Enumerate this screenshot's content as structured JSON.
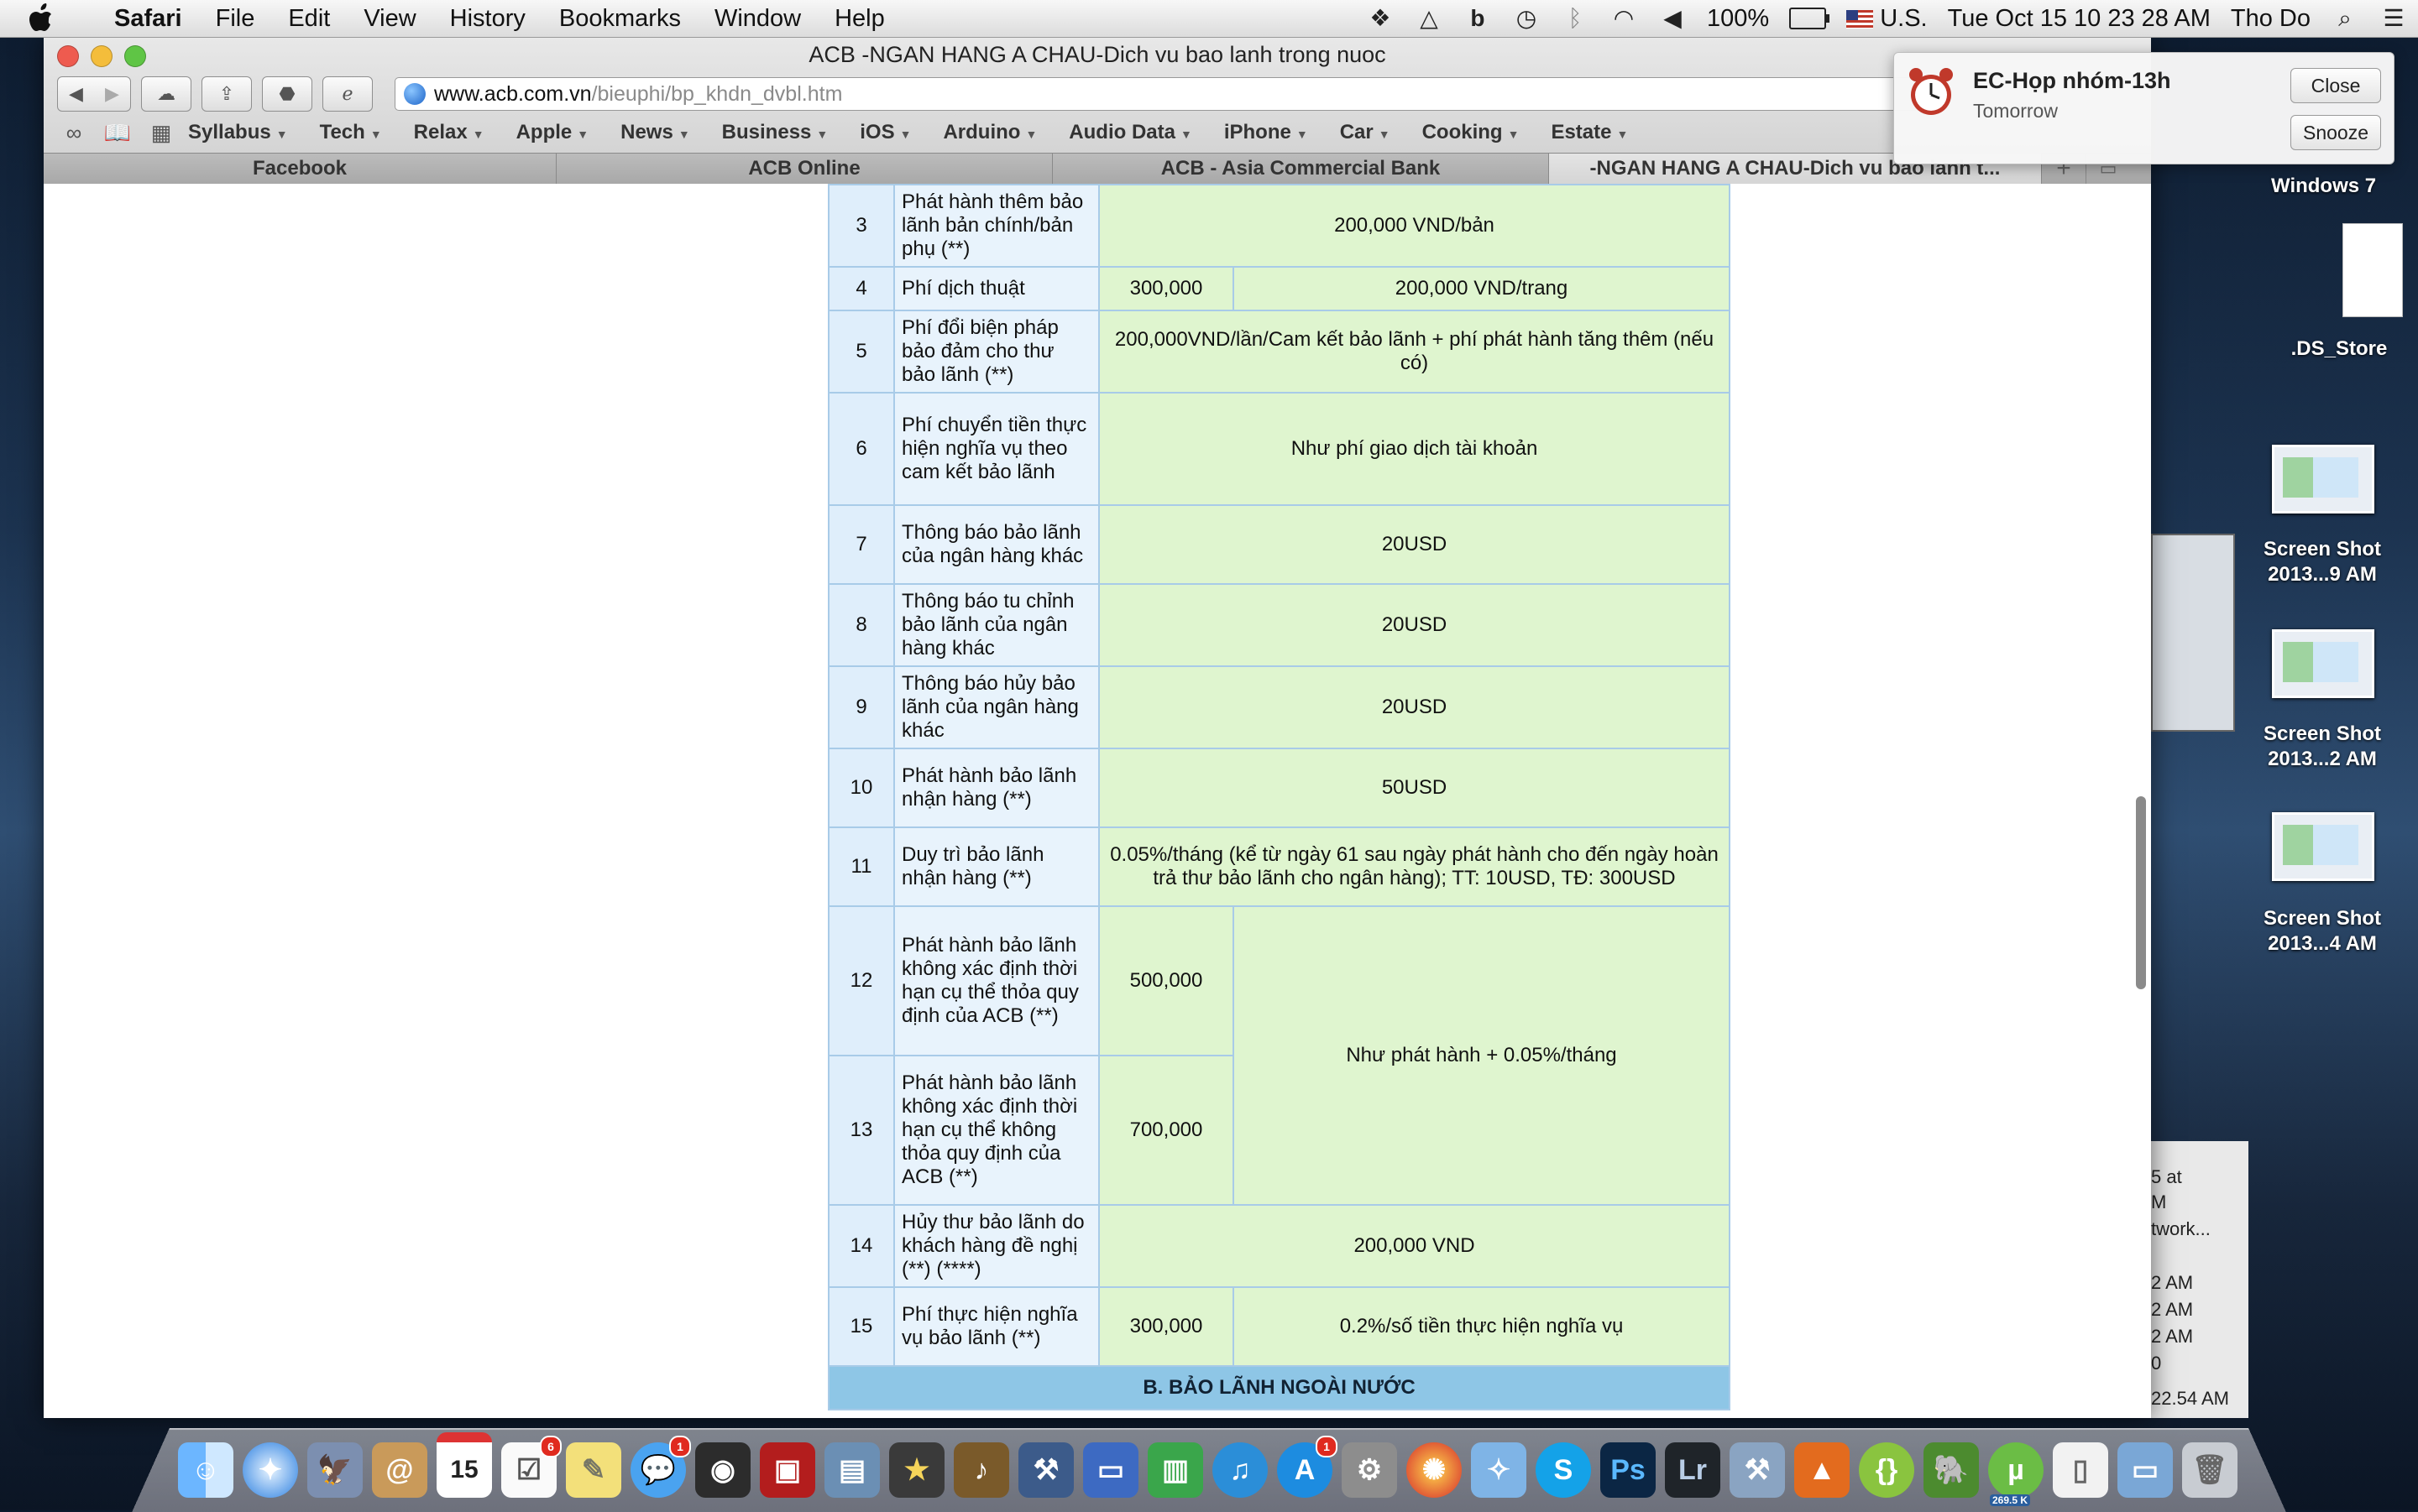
{
  "menubar": {
    "app": "Safari",
    "items": [
      "File",
      "Edit",
      "View",
      "History",
      "Bookmarks",
      "Window",
      "Help"
    ],
    "battery": "100%",
    "input_source": "U.S.",
    "datetime": "Tue Oct 15  10 23 28 AM",
    "user": "Tho Do"
  },
  "window": {
    "title": "ACB -NGAN HANG A CHAU-Dich vu bao lanh trong nuoc",
    "url_host": "www.acb.com.vn",
    "url_path": "/bieuphi/bp_khdn_dvbl.htm",
    "bookmarks": [
      "Syllabus",
      "Tech",
      "Relax",
      "Apple",
      "News",
      "Business",
      "iOS",
      "Arduino",
      "Audio Data",
      "iPhone",
      "Car",
      "Cooking",
      "Estate"
    ],
    "tabs": [
      "Facebook",
      "ACB Online",
      "ACB - Asia Commercial Bank",
      "-NGAN HANG A CHAU-Dich vu bao lanh t..."
    ]
  },
  "table": {
    "rows": {
      "r3": {
        "no": "3",
        "name": "Phát hành thêm bảo lãnh bản chính/bản phụ (**)",
        "value": "200,000 VND/bản"
      },
      "r4": {
        "no": "4",
        "name": "Phí dịch thuật",
        "min": "300,000",
        "value": "200,000 VND/trang"
      },
      "r5": {
        "no": "5",
        "name": "Phí đổi biện pháp bảo đảm cho thư bảo lãnh (**)",
        "value": "200,000VND/lần/Cam kết bảo lãnh + phí phát hành tăng thêm (nếu có)"
      },
      "r6": {
        "no": "6",
        "name": "Phí chuyển tiền thực hiện nghĩa vụ theo cam kết bảo lãnh",
        "value": "Như phí giao dịch tài khoản"
      },
      "r7": {
        "no": "7",
        "name": "Thông báo bảo lãnh của ngân hàng khác",
        "value": "20USD"
      },
      "r8": {
        "no": "8",
        "name": "Thông báo tu chỉnh bảo lãnh của ngân hàng khác",
        "value": "20USD"
      },
      "r9": {
        "no": "9",
        "name": "Thông báo hủy bảo lãnh của ngân hàng khác",
        "value": "20USD"
      },
      "r10": {
        "no": "10",
        "name": "Phát hành bảo lãnh nhận hàng (**)",
        "value": "50USD"
      },
      "r11": {
        "no": "11",
        "name": "Duy trì bảo lãnh nhận hàng (**)",
        "value": "0.05%/tháng (kể từ ngày 61 sau ngày phát hành cho đến ngày hoàn trả thư bảo lãnh cho ngân hàng); TT: 10USD, TĐ: 300USD"
      },
      "r12": {
        "no": "12",
        "name": "Phát hành bảo lãnh không xác định thời hạn cụ thể thỏa quy định của ACB (**)",
        "min": "500,000",
        "value": "Như phát hành + 0.05%/tháng"
      },
      "r13": {
        "no": "13",
        "name": "Phát hành bảo lãnh không xác định thời hạn cụ thể không thỏa quy định của ACB (**)",
        "min": "700,000"
      },
      "r14": {
        "no": "14",
        "name": "Hủy thư bảo lãnh do khách hàng đề nghị (**) (****)",
        "value": "200,000 VND"
      },
      "r15": {
        "no": "15",
        "name": "Phí thực hiện nghĩa vụ bảo lãnh (**)",
        "min": "300,000",
        "value": "0.2%/số tiền thực hiện nghĩa vụ"
      }
    },
    "section_b": "B. BẢO LÃNH NGOÀI NƯỚC"
  },
  "notification": {
    "title": "EC-Họp nhóm-13h",
    "subtitle": "Tomorrow",
    "close_label": "Close",
    "snooze_label": "Snooze"
  },
  "desktop": {
    "volume": "Windows 7",
    "file": ".DS_Store",
    "shots": [
      {
        "line1": "Screen Shot",
        "line2": "2013...9 AM"
      },
      {
        "line1": "Screen Shot",
        "line2": "2013...2 AM"
      },
      {
        "line1": "Screen Shot",
        "line2": "2013...4 AM"
      }
    ],
    "peek_lines": [
      "5 at",
      "M",
      "twork...",
      "2 AM",
      "2 AM",
      "2 AM",
      "0",
      "22.54 AM"
    ]
  },
  "dock": {
    "calendar_day": "15",
    "badges": {
      "reminders": "6",
      "messages": "1",
      "appstore": "1"
    },
    "photoshop": "Ps",
    "lightroom": "Lr",
    "utorrent_rate": "269.5 K"
  }
}
